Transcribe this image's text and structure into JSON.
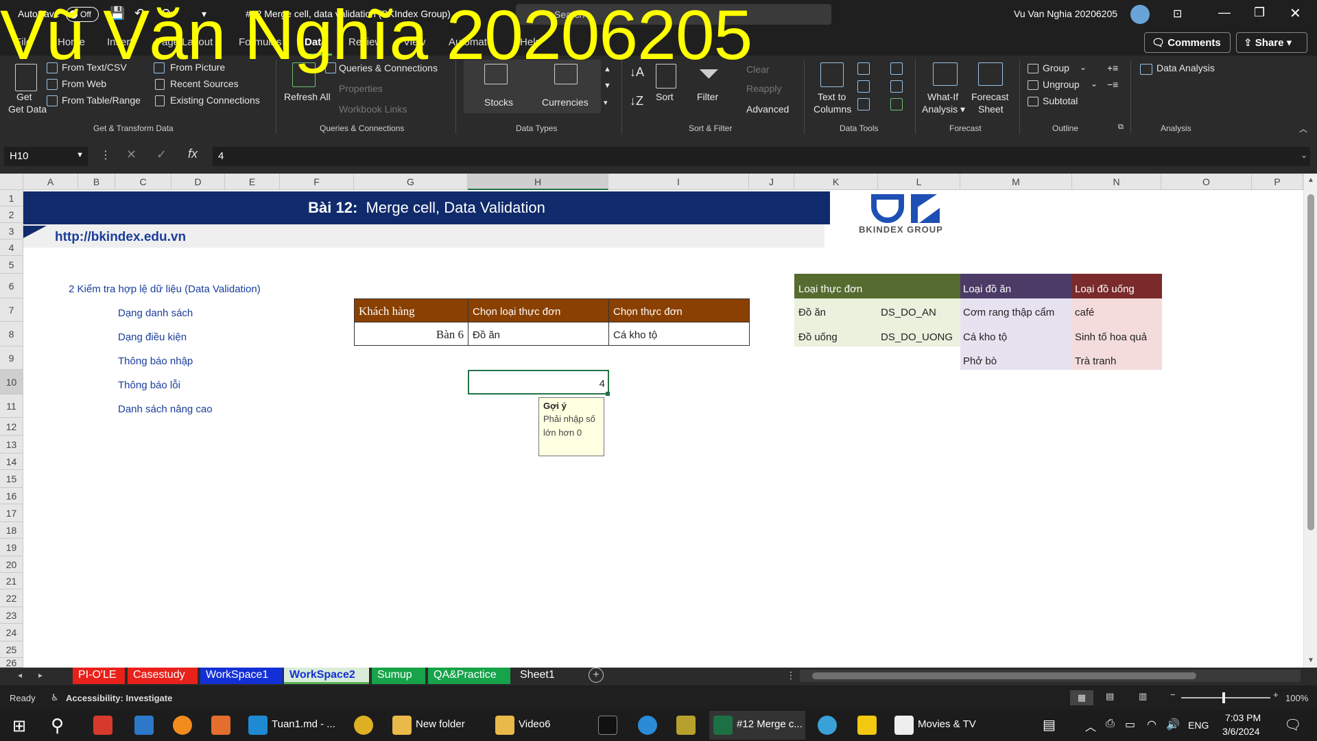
{
  "titlebar": {
    "autosave_label": "AutoSave",
    "autosave_state": "Off",
    "doc_title": "#12 Merge cell, data validation (BKIndex Group)",
    "search_placeholder": "Search",
    "user_name": "Vu Van Nghia 20206205"
  },
  "tabs": [
    "File",
    "Home",
    "Insert",
    "Page Layout",
    "Formulas",
    "Data",
    "Review",
    "View",
    "Automate",
    "Help"
  ],
  "active_tab": "Data",
  "comments_label": "Comments",
  "share_label": "Share",
  "ribbon": {
    "get_data": "Get Data",
    "from_text": "From Text/CSV",
    "from_web": "From Web",
    "from_table": "From Table/Range",
    "from_picture": "From Picture",
    "recent_sources": "Recent Sources",
    "existing_connections": "Existing Connections",
    "group_get_transform": "Get & Transform Data",
    "refresh_all": "Refresh All",
    "queries_connections": "Queries & Connections",
    "properties": "Properties",
    "workbook_links": "Workbook Links",
    "group_queries": "Queries & Connections",
    "stocks": "Stocks",
    "currencies": "Currencies",
    "group_data_types": "Data Types",
    "sort": "Sort",
    "filter": "Filter",
    "clear": "Clear",
    "reapply": "Reapply",
    "advanced": "Advanced",
    "group_sort_filter": "Sort & Filter",
    "text_to_columns": "Text to Columns",
    "group_data_tools": "Data Tools",
    "what_if": "What-If Analysis",
    "forecast_sheet": "Forecast Sheet",
    "group_forecast": "Forecast",
    "group_btn": "Group",
    "ungroup_btn": "Ungroup",
    "subtotal": "Subtotal",
    "group_outline": "Outline",
    "data_analysis": "Data Analysis",
    "group_analysis": "Analysis"
  },
  "formula": {
    "name_box": "H10",
    "value": "4"
  },
  "columns": [
    "A",
    "B",
    "C",
    "D",
    "E",
    "F",
    "G",
    "H",
    "I",
    "J",
    "K",
    "L",
    "M",
    "N",
    "O",
    "P"
  ],
  "rows": [
    "1",
    "2",
    "3",
    "4",
    "5",
    "6",
    "7",
    "8",
    "9",
    "10",
    "11",
    "12",
    "13",
    "14",
    "15",
    "16",
    "17",
    "18",
    "19",
    "20",
    "21",
    "22",
    "23",
    "24",
    "25",
    "26"
  ],
  "sheet": {
    "banner_bold": "Bài 12:",
    "banner_text": "Merge cell, Data Validation",
    "url": "http://bkindex.edu.vn",
    "logo_text": "BKINDEX GROUP",
    "section_title": "2  Kiểm tra hợp lệ dữ liệu (Data Validation)",
    "items": [
      "Dạng danh sách",
      "Dạng điều kiện",
      "Thông báo nhập",
      "Thông báo lỗi",
      "Danh sách nâng cao"
    ],
    "table_headers": [
      "Khách hàng",
      "Chọn loại thực đơn",
      "Chọn thực đơn"
    ],
    "table_row": [
      "Bàn 6",
      "Đồ ăn",
      "Cá kho tộ"
    ],
    "h10_value": "4",
    "tooltip_title": "Gợi ý",
    "tooltip_body": "Phải nhập số lớn hơn 0",
    "menu_header": "Loại thực đơn",
    "food_header": "Loại đồ ăn",
    "drink_header": "Loại đồ uống",
    "menu_rows": [
      [
        "Đồ ăn",
        "DS_DO_AN"
      ],
      [
        "Đồ uống",
        "DS_DO_UONG"
      ]
    ],
    "foods": [
      "Cơm rang thập cẩm",
      "Cá kho tộ",
      "Phở bò"
    ],
    "drinks": [
      "café",
      "Sinh tố hoa quả",
      "Trà tranh"
    ]
  },
  "sheet_tabs": [
    {
      "name": "PI-O'LE",
      "color": "#e8211b"
    },
    {
      "name": "Casestudy",
      "color": "#e8211b"
    },
    {
      "name": "WorkSpace1",
      "color": "#1330d6"
    },
    {
      "name": "WorkSpace2",
      "color": "#d9ecd9"
    },
    {
      "name": "Sumup",
      "color": "#16a34a"
    },
    {
      "name": "QA&Practice",
      "color": "#16a34a"
    },
    {
      "name": "Sheet1",
      "color": "#2b2b2b"
    }
  ],
  "status": {
    "ready": "Ready",
    "accessibility": "Accessibility: Investigate",
    "zoom": "100%"
  },
  "taskbar": {
    "items": [
      "Tuan1.md - ...",
      "New folder",
      "Video6",
      "#12 Merge c...",
      "Movies & TV"
    ],
    "lang": "ENG",
    "time": "7:03 PM",
    "date": "3/6/2024"
  },
  "watermark": "Vũ Văn Nghĩa 20206205",
  "colors": {
    "banner": "#102a6b",
    "table_header": "#8a4000",
    "menu_green": "#556b2f",
    "food_purple": "#4b3b66",
    "drink_red": "#7a2a2a",
    "accent_green": "#5db35a"
  }
}
